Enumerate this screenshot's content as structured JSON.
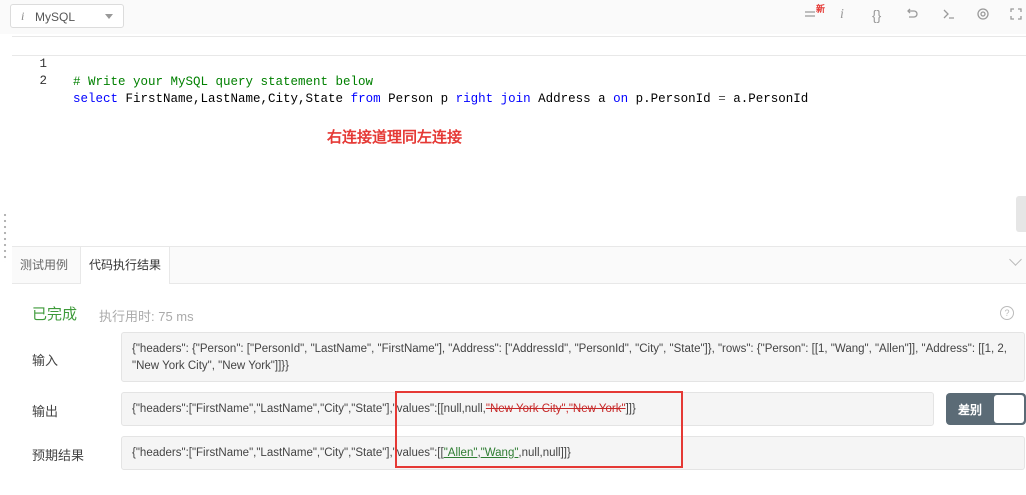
{
  "toolbar": {
    "language": "MySQL",
    "info_glyph": "i",
    "new_badge": "新",
    "icons": [
      "format-icon",
      "info-icon",
      "braces-icon",
      "reset-icon",
      "console-icon",
      "settings-icon",
      "fullscreen-icon"
    ]
  },
  "editor": {
    "lines": [
      {
        "num": "1",
        "comment": "# Write your MySQL query statement below"
      },
      {
        "num": "2",
        "tokens": {
          "select": "select",
          "fields": " FirstName,LastName,City,State ",
          "from": "from",
          "person": " Person p ",
          "right": "right",
          "sp": " ",
          "join": "join",
          "address": " Address a ",
          "on": "on",
          "cond1": " p.PersonId ",
          "eq": "=",
          "cond2": " a.PersonId"
        }
      }
    ],
    "annotation": "右连接道理同左连接"
  },
  "tabs": [
    "测试用例",
    "代码执行结果"
  ],
  "result": {
    "status": "已完成",
    "exec_time": "执行用时: 75 ms",
    "help": "?",
    "labels": {
      "input": "输入",
      "output": "输出",
      "expected": "预期结果"
    },
    "input": "{\"headers\": {\"Person\": [\"PersonId\", \"LastName\", \"FirstName\"], \"Address\": [\"AddressId\", \"PersonId\", \"City\", \"State\"]}, \"rows\": {\"Person\": [[1, \"Wang\", \"Allen\"]], \"Address\": [[1, 2, \"New York City\", \"New York\"]]}}",
    "output": {
      "prefix": "{\"headers\":[\"FirstName\",\"LastName\",\"City\",\"State\"],\"values\":[[null,null,",
      "deleted": "\"New York City\",\"New York\"",
      "suffix": "]]}"
    },
    "expected": {
      "prefix": "{\"headers\":[\"FirstName\",\"LastName\",\"City\",\"State\"],\"values\":[[",
      "ins1": "\"Allen\"",
      "comma": ",",
      "ins2": "\"Wang\"",
      "suffix": ",null,null]]}"
    },
    "diff_label": "差别"
  },
  "colors": {
    "status_green": "#3e9a3a",
    "annotation_red": "#e53935",
    "keyword_blue": "#0000ff",
    "comment_green": "#008000"
  }
}
